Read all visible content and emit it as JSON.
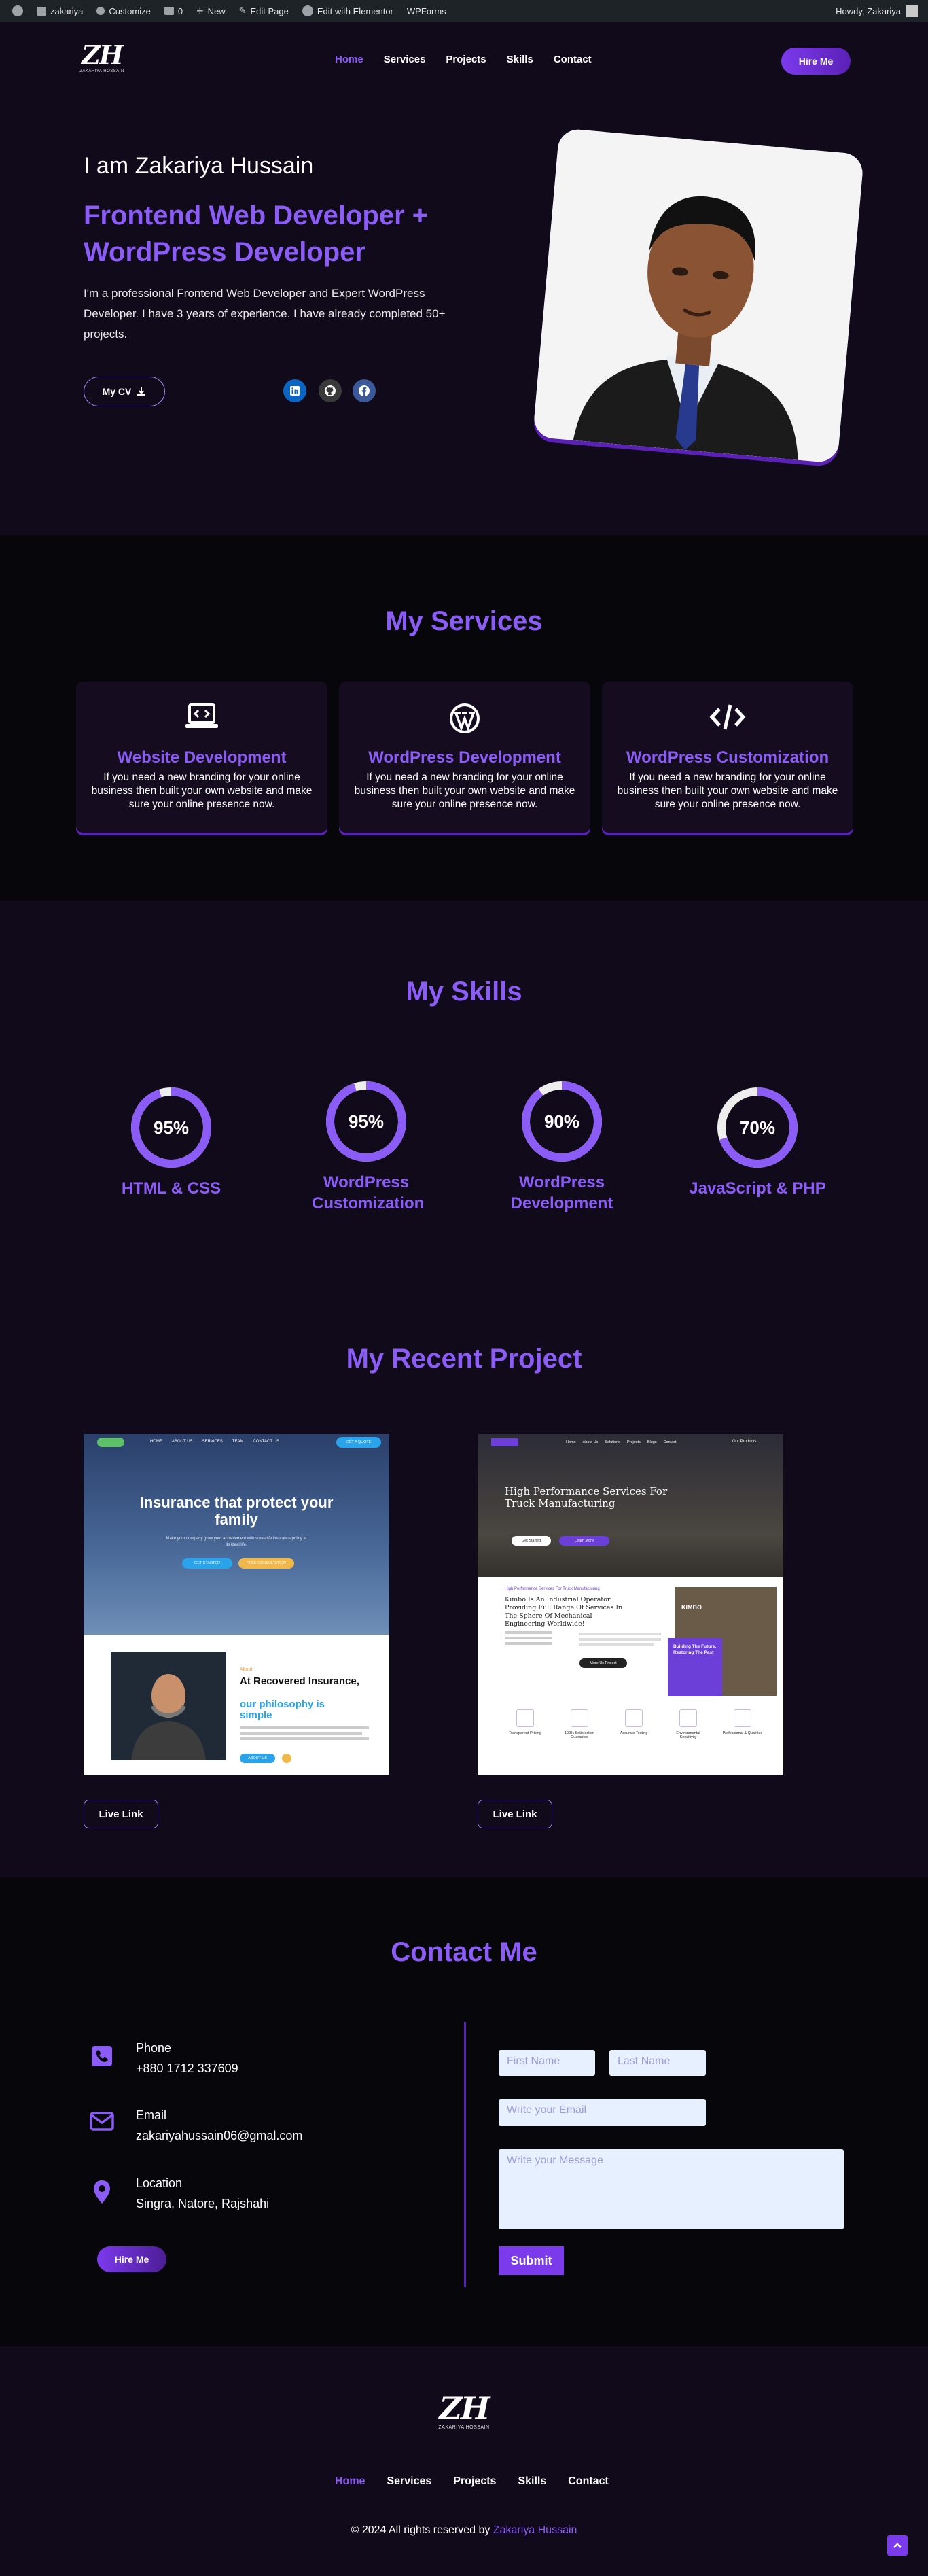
{
  "admin_bar": {
    "site_name": "zakariya",
    "customize": "Customize",
    "comments": "0",
    "new": "New",
    "edit_page": "Edit Page",
    "elementor": "Edit with Elementor",
    "wpforms": "WPForms",
    "howdy": "Howdy, Zakariya"
  },
  "logo": {
    "mark": "ZH",
    "text": "ZAKARIYA HOSSAIN"
  },
  "nav": {
    "items": [
      "Home",
      "Services",
      "Projects",
      "Skills",
      "Contact"
    ],
    "active": "Home",
    "hire_label": "Hire Me"
  },
  "hero": {
    "greeting": "I am Zakariya Hussain",
    "title": "Frontend Web Developer + WordPress Developer",
    "description": "I'm a professional Frontend Web Developer and Expert WordPress Developer. I have 3 years of experience. I have already completed 50+ projects.",
    "cv_label": "My CV",
    "social_icons": [
      "linkedin-icon",
      "github-icon",
      "facebook-icon"
    ]
  },
  "services": {
    "title": "My Services",
    "cards": [
      {
        "icon": "laptop-code-icon",
        "title": "Website Development",
        "text": "If you need a new branding for your online business then built your own website and make sure your online presence now."
      },
      {
        "icon": "wordpress-icon",
        "title": "WordPress Development",
        "text": "If you need a new branding for your online business then built your own website and make sure your online presence now."
      },
      {
        "icon": "code-icon",
        "title": "WordPress Customization",
        "text": "If you need a new branding for your online business then built your own website and make sure your online presence now."
      }
    ]
  },
  "skills": {
    "title": "My Skills",
    "items": [
      {
        "value": 95,
        "percent_label": "95%",
        "label": "HTML & CSS"
      },
      {
        "value": 95,
        "percent_label": "95%",
        "label": "WordPress Customization"
      },
      {
        "value": 90,
        "percent_label": "90%",
        "label": "WordPress Development"
      },
      {
        "value": 70,
        "percent_label": "70%",
        "label": "JavaScript & PHP"
      }
    ],
    "accent": "#8b5cf6"
  },
  "projects": {
    "title": "My Recent Project",
    "items": [
      {
        "live_label": "Live Link",
        "thumb": {
          "nav": [
            "HOME",
            "ABOUT US",
            "SERVICES",
            "TEAM",
            "CONTACT US"
          ],
          "cta": "GET A QUOTE",
          "hero_title": "Insurance that protect your family",
          "hero_sub": "Make your company grow your achievement with some life insurance policy at its ideal life.",
          "btn1": "GET STARTED",
          "btn2": "FREE CONSULTATION",
          "about_label": "About",
          "about_title1": "At Recovered Insurance,",
          "about_title2": "our philosophy is simple",
          "about_btn": "ABOUT US"
        }
      },
      {
        "live_label": "Live Link",
        "thumb": {
          "nav": [
            "Home",
            "About Us",
            "Solutions",
            "Projects",
            "Blogs",
            "Contact"
          ],
          "lang": "Our Products",
          "hero_title": "High Performance Services For Truck Manufacturing",
          "btn1": "Get Started",
          "btn2": "Learn More",
          "kicker": "High Performance Services For Truck Manufacturing",
          "heading": "Kimbo Is An Industrial Operator Providing Full Range Of Services In The Sphere Of Mechanical Engineering Worldwide!",
          "brand": "KIMBO",
          "badge_title": "Building The Future, Restoring The Past",
          "more_btn": "More Us Project",
          "features": [
            "Transparent Pricing",
            "100% Satisfaction Guarantee",
            "Accurate Testing",
            "Environmental Sensitivity",
            "Professional & Qualified"
          ]
        }
      }
    ]
  },
  "contact": {
    "title": "Contact Me",
    "items": [
      {
        "icon": "phone-icon",
        "label": "Phone",
        "value": "+880 1712 337609"
      },
      {
        "icon": "email-icon",
        "label": "Email",
        "value": "zakariyahussain06@gmal.com"
      },
      {
        "icon": "location-icon",
        "label": "Location",
        "value": "Singra, Natore, Rajshahi"
      }
    ],
    "hire_label": "Hire Me",
    "form": {
      "first_name": "First Name",
      "last_name": "Last Name",
      "email": "Write your Email",
      "message": "Write your Message",
      "submit": "Submit"
    }
  },
  "footer": {
    "nav": [
      "Home",
      "Services",
      "Projects",
      "Skills",
      "Contact"
    ],
    "copyright": "© 2024 All rights reserved by",
    "author": "Zakariya Hussain"
  }
}
